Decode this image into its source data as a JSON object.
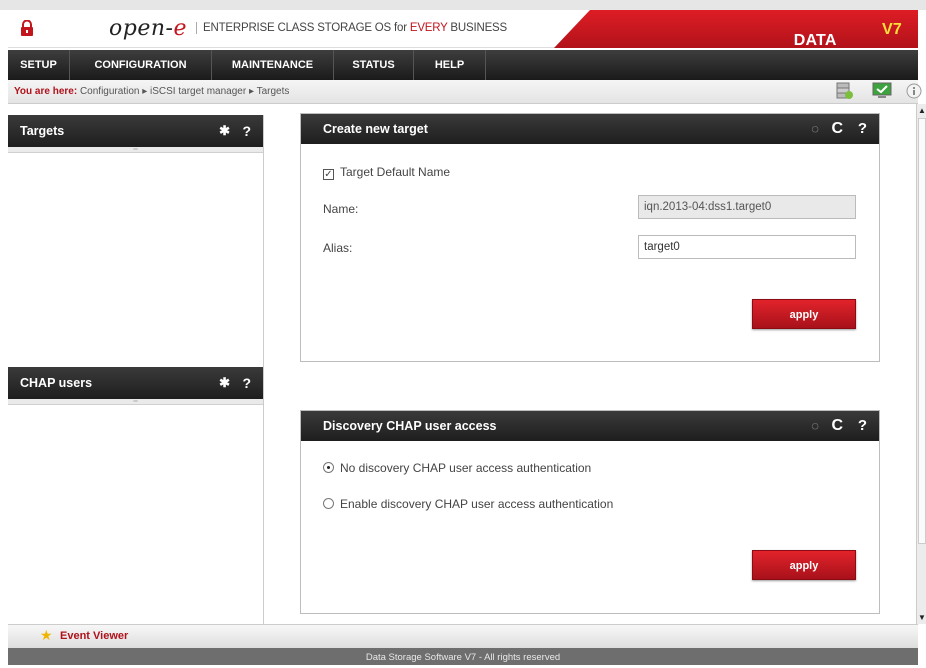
{
  "header": {
    "logo_main": "open-",
    "logo_e": "e",
    "tagline_pre": "ENTERPRISE CLASS STORAGE OS for ",
    "tagline_every": "EVERY",
    "tagline_post": " BUSINESS",
    "brand_main": "DATA STORAGE SOFTWARE ",
    "brand_version": "V7"
  },
  "menu": [
    {
      "label": "SETUP"
    },
    {
      "label": "CONFIGURATION"
    },
    {
      "label": "MAINTENANCE"
    },
    {
      "label": "STATUS"
    },
    {
      "label": "HELP"
    }
  ],
  "breadcrumb": {
    "prefix": "You are here:",
    "path": "Configuration ▸ iSCSI target manager ▸ Targets"
  },
  "left_panels": {
    "targets": {
      "title": "Targets"
    },
    "chap": {
      "title": "CHAP users"
    }
  },
  "create_target": {
    "title": "Create new target",
    "default_name_label": "Target Default Name",
    "name_label": "Name:",
    "name_value": "iqn.2013-04:dss1.target0",
    "alias_label": "Alias:",
    "alias_value": "target0",
    "apply_label": "apply"
  },
  "discovery": {
    "title": "Discovery CHAP user access",
    "option_no": "No discovery CHAP user access authentication",
    "option_enable": "Enable discovery CHAP user access authentication",
    "apply_label": "apply"
  },
  "bottom": {
    "event_viewer": "Event Viewer",
    "footer": "Data Storage Software V7 - All rights reserved"
  },
  "colors": {
    "brand_red": "#c3151e",
    "dark_bar": "#262626",
    "version_yellow": "#ffdf3a"
  }
}
